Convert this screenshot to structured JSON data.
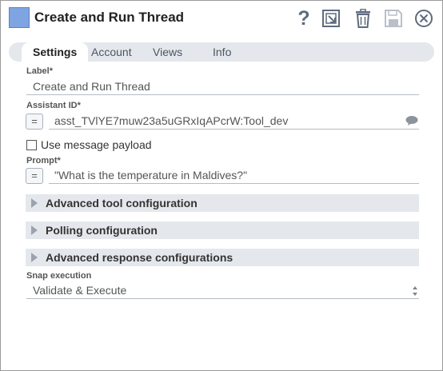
{
  "window": {
    "title": "Create and Run Thread",
    "accent": "#7ea4e2"
  },
  "toolbar": {
    "help": "?",
    "icons": [
      "help-icon",
      "export-icon",
      "delete-icon",
      "save-icon",
      "close-icon"
    ]
  },
  "tabs": [
    {
      "label": "Settings",
      "active": true
    },
    {
      "label": "Account",
      "active": false
    },
    {
      "label": "Views",
      "active": false
    },
    {
      "label": "Info",
      "active": false
    }
  ],
  "fields": {
    "label": {
      "label": "Label*",
      "value": "Create and Run Thread"
    },
    "assistant_id": {
      "label": "Assistant ID*",
      "value": "asst_TVlYE7muw23a5uGRxIqAPcrW:Tool_dev",
      "expr_button": "="
    },
    "use_message_payload": {
      "label": "Use message payload",
      "checked": false
    },
    "prompt": {
      "label": "Prompt*",
      "value": "\"What is the temperature in Maldives?\"",
      "expr_button": "="
    },
    "snap_execution": {
      "label": "Snap execution",
      "value": "Validate & Execute"
    }
  },
  "sections": [
    {
      "label": "Advanced tool configuration"
    },
    {
      "label": "Polling configuration"
    },
    {
      "label": "Advanced response configurations"
    }
  ]
}
